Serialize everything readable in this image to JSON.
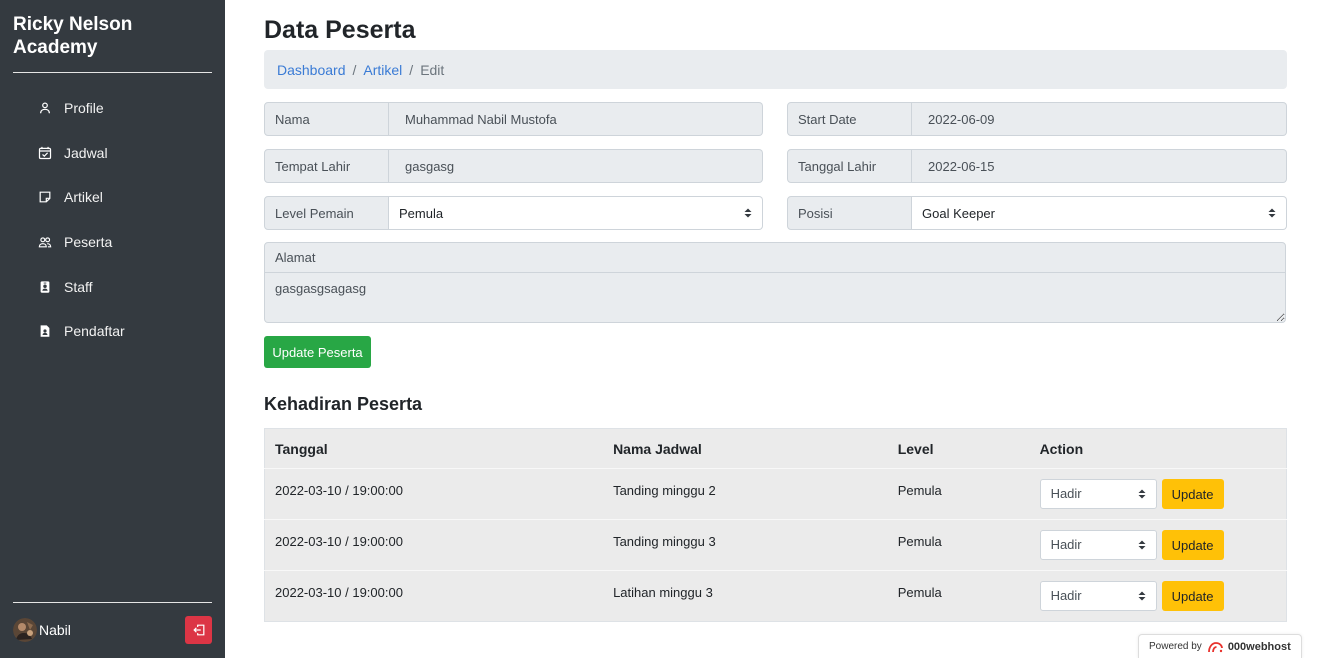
{
  "sidebar": {
    "brand": "Ricky Nelson Academy",
    "menu": [
      {
        "label": "Profile",
        "icon": "person-icon"
      },
      {
        "label": "Jadwal",
        "icon": "calendar-check-icon"
      },
      {
        "label": "Artikel",
        "icon": "sticky-note-icon"
      },
      {
        "label": "Peserta",
        "icon": "people-icon"
      },
      {
        "label": "Staff",
        "icon": "person-badge-icon"
      },
      {
        "label": "Pendaftar",
        "icon": "file-person-icon"
      }
    ],
    "user": {
      "name": "Nabil",
      "avatar_icon": "avatar-photo",
      "logout_icon": "logout-icon"
    }
  },
  "page": {
    "title": "Data Peserta"
  },
  "breadcrumb": {
    "items": [
      "Dashboard",
      "Artikel",
      "Edit"
    ],
    "separator": "/"
  },
  "form": {
    "nama": {
      "label": "Nama",
      "value": "Muhammad Nabil Mustofa"
    },
    "start_date": {
      "label": "Start Date",
      "value": "2022-06-09"
    },
    "tempat_lahir": {
      "label": "Tempat Lahir",
      "value": "gasgasg"
    },
    "tanggal_lahir": {
      "label": "Tanggal Lahir",
      "value": "2022-06-15"
    },
    "level_pemain": {
      "label": "Level Pemain",
      "selected": "Pemula"
    },
    "posisi": {
      "label": "Posisi",
      "selected": "Goal Keeper"
    },
    "alamat": {
      "label": "Alamat",
      "value": "gasgasgsagasg"
    },
    "submit_label": "Update Peserta"
  },
  "attendance": {
    "heading": "Kehadiran Peserta",
    "columns": [
      "Tanggal",
      "Nama Jadwal",
      "Level",
      "Action"
    ],
    "rows": [
      {
        "tanggal": "2022-03-10 / 19:00:00",
        "nama_jadwal": "Tanding minggu 2",
        "level": "Pemula",
        "status": "Hadir",
        "action_label": "Update"
      },
      {
        "tanggal": "2022-03-10 / 19:00:00",
        "nama_jadwal": "Tanding minggu 3",
        "level": "Pemula",
        "status": "Hadir",
        "action_label": "Update"
      },
      {
        "tanggal": "2022-03-10 / 19:00:00",
        "nama_jadwal": "Latihan minggu 3",
        "level": "Pemula",
        "status": "Hadir",
        "action_label": "Update"
      }
    ]
  },
  "footer_badge": {
    "prefix": "Powered by",
    "brand": "000webhost"
  },
  "colors": {
    "sidebar_bg": "#343a40",
    "link": "#3a7bd5",
    "success": "#28a745",
    "warning": "#ffc107",
    "danger": "#dc3545",
    "table_bg": "#ebebeb"
  }
}
